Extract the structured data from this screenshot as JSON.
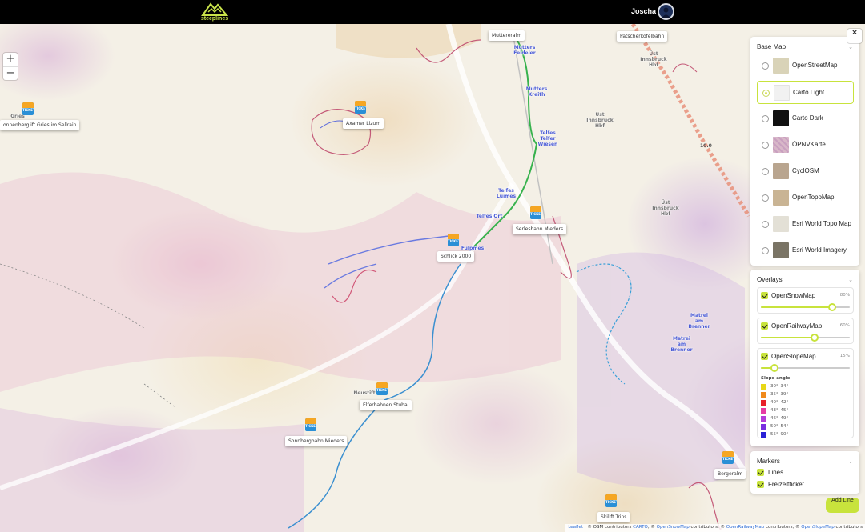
{
  "header": {
    "logo_text": "steeplines",
    "user_name": "Joscha"
  },
  "map_controls": {
    "zoom_in": "+",
    "zoom_out": "−",
    "close": "×"
  },
  "place_labels": [
    {
      "text": "Mutters Feldeler"
    },
    {
      "text": "Mutters Kreith"
    },
    {
      "text": "Telfes Telfer Wiesen"
    },
    {
      "text": "Telfes Luimes"
    },
    {
      "text": "Telfes Ort"
    },
    {
      "text": "Fulpmes"
    },
    {
      "text": "Matrei am Brenner"
    },
    {
      "text": "Matrei am Brenner"
    },
    {
      "text": "Ust Innsbruck Hbf"
    },
    {
      "text": "Üst Innsbruck Hbf"
    },
    {
      "text": "Üst Innsbruck Hbf"
    },
    {
      "text": "10.0"
    },
    {
      "text": "Neustift"
    },
    {
      "text": "Gries"
    }
  ],
  "ski_areas": [
    {
      "label": "Muttereralm"
    },
    {
      "label": "Patscherkofelbahn"
    },
    {
      "label": "Axamer Lizum"
    },
    {
      "label": "onnenberglift Gries im Sellrain"
    },
    {
      "label": "Serlesbahn Mieders"
    },
    {
      "label": "Schlick 2000"
    },
    {
      "label": "Elferbahnen Stubai"
    },
    {
      "label": "Sonnbergbahn Mieders"
    },
    {
      "label": "Bergeralm"
    },
    {
      "label": "Skilift Trins"
    }
  ],
  "marker_badge": "TICKET",
  "base_map": {
    "title": "Base Map",
    "options": [
      {
        "label": "OpenStreetMap",
        "selected": false,
        "thumb_color": "#d9d3b8"
      },
      {
        "label": "Carto Light",
        "selected": true,
        "thumb_color": "#f1f1f1"
      },
      {
        "label": "Carto Dark",
        "selected": false,
        "thumb_color": "#111111"
      },
      {
        "label": "ÖPNVKarte",
        "selected": false,
        "thumb_color": "#d8b7c8"
      },
      {
        "label": "CyclOSM",
        "selected": false,
        "thumb_color": "#b9a58f"
      },
      {
        "label": "OpenTopoMap",
        "selected": false,
        "thumb_color": "#c9b494"
      },
      {
        "label": "Esri World Topo Map",
        "selected": false,
        "thumb_color": "#e3e0d6"
      },
      {
        "label": "Esri World Imagery",
        "selected": false,
        "thumb_color": "#7a7465"
      }
    ]
  },
  "overlays": {
    "title": "Overlays",
    "items": [
      {
        "label": "OpenSnowMap",
        "checked": true,
        "percent_label": "80%",
        "opacity": 0.8
      },
      {
        "label": "OpenRailwayMap",
        "checked": true,
        "percent_label": "60%",
        "opacity": 0.6
      },
      {
        "label": "OpenSlopeMap",
        "checked": true,
        "percent_label": "15%",
        "opacity": 0.15
      }
    ],
    "slope_legend": {
      "title": "Slope angle",
      "entries": [
        {
          "range": "30°–34°",
          "color": "#e8d817"
        },
        {
          "range": "35°–39°",
          "color": "#f08a1c"
        },
        {
          "range": "40°–42°",
          "color": "#e8202a"
        },
        {
          "range": "43°–45°",
          "color": "#e63ca4"
        },
        {
          "range": "46°–49°",
          "color": "#b43cd8"
        },
        {
          "range": "50°–54°",
          "color": "#7a2ee0"
        },
        {
          "range": "55°–90°",
          "color": "#2a22d6"
        }
      ]
    }
  },
  "markers": {
    "title": "Markers",
    "items": [
      {
        "label": "Lines",
        "checked": true
      },
      {
        "label": "Freizeitticket",
        "checked": true
      }
    ]
  },
  "add_line_label": "Add Line",
  "attribution": {
    "leaflet": "Leaflet",
    "sep1": " | © OSM contributors ",
    "carto": "CARTO",
    "sep2": ", © ",
    "opensnowmap": "OpenSnowMap",
    "sep3": " contributors, © ",
    "openrailwaymap": "OpenRailwayMap",
    "sep4": " contributors, © ",
    "openslopemap": "OpenSlopeMap",
    "sep5": " contributors"
  },
  "colors": {
    "accent": "#c8e33c",
    "topbar": "#000000",
    "railway": "#e8907a",
    "route_green": "#37b24d",
    "river": "#3a8fd0"
  }
}
